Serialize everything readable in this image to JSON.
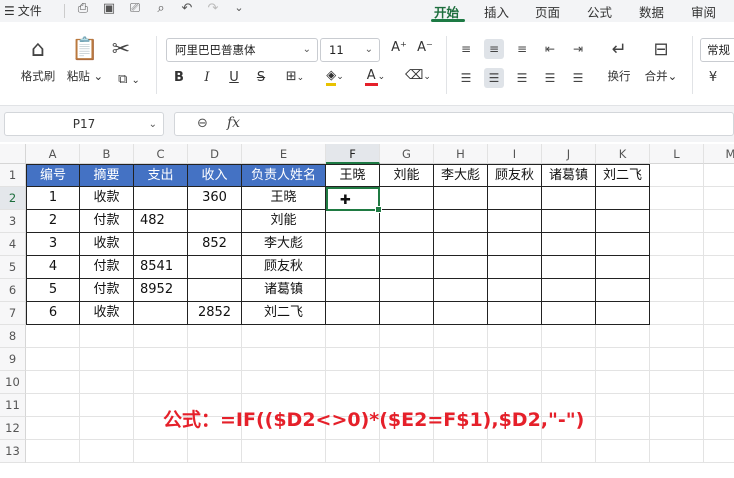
{
  "menu": {
    "file_label": "文件",
    "tabs": [
      "开始",
      "插入",
      "页面",
      "公式",
      "数据",
      "审阅"
    ],
    "active_tab": "开始"
  },
  "ribbon": {
    "format_painter": "格式刷",
    "paste": "粘贴",
    "font_name": "阿里巴巴普惠体",
    "font_size": "11",
    "wrap": "换行",
    "merge": "合并",
    "number_format": "常规",
    "bold": "B",
    "italic": "I",
    "underline": "U",
    "strike": "S",
    "font_color_letter": "A",
    "increase_font": "A⁺",
    "decrease_font": "A⁻",
    "currency": "¥"
  },
  "formula_bar": {
    "name_box": "P17",
    "fx": "fx",
    "content": ""
  },
  "grid": {
    "columns": [
      "A",
      "B",
      "C",
      "D",
      "E",
      "F",
      "G",
      "H",
      "I",
      "J",
      "K",
      "L",
      "M"
    ],
    "rows": [
      "1",
      "2",
      "3",
      "4",
      "5",
      "6",
      "7",
      "8",
      "9",
      "10",
      "11",
      "12",
      "13"
    ],
    "selected_cell": "F2",
    "header_row": [
      "编号",
      "摘要",
      "支出",
      "收入",
      "负责人姓名",
      "王晓",
      "刘能",
      "李大彪",
      "顾友秋",
      "诸葛镇",
      "刘二飞"
    ],
    "data_rows": [
      [
        "1",
        "收款",
        "",
        "360",
        "王晓",
        "",
        "",
        "",
        "",
        "",
        ""
      ],
      [
        "2",
        "付款",
        "482",
        "",
        "刘能",
        "",
        "",
        "",
        "",
        "",
        ""
      ],
      [
        "3",
        "收款",
        "",
        "852",
        "李大彪",
        "",
        "",
        "",
        "",
        "",
        ""
      ],
      [
        "4",
        "付款",
        "8541",
        "",
        "顾友秋",
        "",
        "",
        "",
        "",
        "",
        ""
      ],
      [
        "5",
        "付款",
        "8952",
        "",
        "诸葛镇",
        "",
        "",
        "",
        "",
        "",
        ""
      ],
      [
        "6",
        "收款",
        "",
        "2852",
        "刘二飞",
        "",
        "",
        "",
        "",
        "",
        ""
      ]
    ]
  },
  "annotation": "公式：=IF(($D2<>0)*($E2=F$1),$D2,\"-\")",
  "colors": {
    "accent": "#1d7a44",
    "header_fill": "#4472c4",
    "annotation": "#e5202a"
  }
}
